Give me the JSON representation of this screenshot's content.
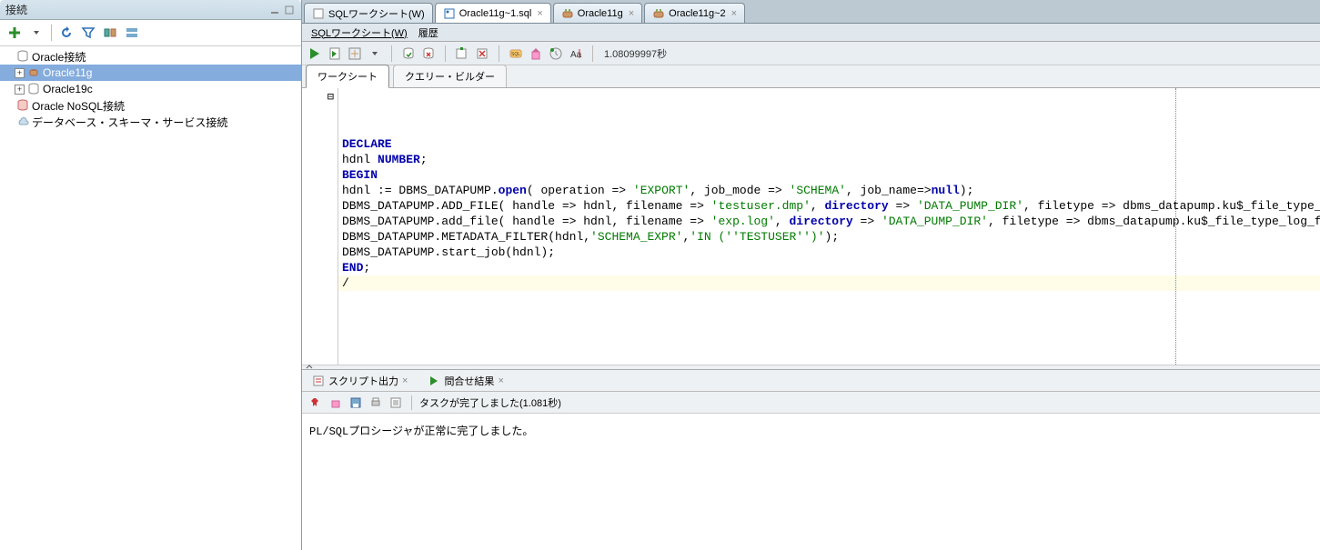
{
  "left": {
    "title": "接続",
    "tree": {
      "root": "Oracle接続",
      "items": [
        {
          "label": "Oracle11g",
          "selected": true,
          "expandable": true
        },
        {
          "label": "Oracle19c",
          "selected": false,
          "expandable": true
        }
      ],
      "nosql": "Oracle NoSQL接続",
      "dbservice": "データベース・スキーマ・サービス接続"
    }
  },
  "tabs": [
    {
      "label": "SQLワークシート(W)",
      "active": false,
      "icon": "sql"
    },
    {
      "label": "Oracle11g~1.sql",
      "active": true,
      "icon": "file"
    },
    {
      "label": "Oracle11g",
      "active": false,
      "icon": "conn"
    },
    {
      "label": "Oracle11g~2",
      "active": false,
      "icon": "conn"
    }
  ],
  "subtitle": {
    "ws": "SQLワークシート(W)",
    "history": "履歴"
  },
  "toolbar": {
    "duration": "1.08099997秒"
  },
  "wsTabs": {
    "worksheet": "ワークシート",
    "builder": "クエリー・ビルダー"
  },
  "code": {
    "lines": [
      [
        {
          "t": "DECLARE",
          "c": "kw"
        }
      ],
      [
        {
          "t": "hdnl "
        },
        {
          "t": "NUMBER",
          "c": "kw"
        },
        {
          "t": ";"
        }
      ],
      [
        {
          "t": "BEGIN",
          "c": "kw"
        }
      ],
      [
        {
          "t": "hdnl := DBMS_DATAPUMP."
        },
        {
          "t": "open",
          "c": "kw"
        },
        {
          "t": "( operation => "
        },
        {
          "t": "'EXPORT'",
          "c": "str"
        },
        {
          "t": ", job_mode => "
        },
        {
          "t": "'SCHEMA'",
          "c": "str"
        },
        {
          "t": ", job_name=>"
        },
        {
          "t": "null",
          "c": "kw"
        },
        {
          "t": ");"
        }
      ],
      [
        {
          "t": "DBMS_DATAPUMP.ADD_FILE( handle => hdnl, filename => "
        },
        {
          "t": "'testuser.dmp'",
          "c": "str"
        },
        {
          "t": ", "
        },
        {
          "t": "directory",
          "c": "kw"
        },
        {
          "t": " => "
        },
        {
          "t": "'DATA_PUMP_DIR'",
          "c": "str"
        },
        {
          "t": ", filetype => dbms_datapump.ku$_file_type_dump_file);"
        }
      ],
      [
        {
          "t": "DBMS_DATAPUMP.add_file( handle => hdnl, filename => "
        },
        {
          "t": "'exp.log'",
          "c": "str"
        },
        {
          "t": ", "
        },
        {
          "t": "directory",
          "c": "kw"
        },
        {
          "t": " => "
        },
        {
          "t": "'DATA_PUMP_DIR'",
          "c": "str"
        },
        {
          "t": ", filetype => dbms_datapump.ku$_file_type_log_file);"
        }
      ],
      [
        {
          "t": "DBMS_DATAPUMP.METADATA_FILTER(hdnl,"
        },
        {
          "t": "'SCHEMA_EXPR'",
          "c": "str"
        },
        {
          "t": ","
        },
        {
          "t": "'IN (''TESTUSER'')'",
          "c": "str"
        },
        {
          "t": ");"
        }
      ],
      [
        {
          "t": "DBMS_DATAPUMP.start_job(hdnl);"
        }
      ],
      [
        {
          "t": "END",
          "c": "kw"
        },
        {
          "t": ";"
        }
      ],
      [
        {
          "t": "/"
        }
      ]
    ],
    "currentLine": 9
  },
  "result": {
    "tabs": [
      {
        "label": "スクリプト出力",
        "icon": "script"
      },
      {
        "label": "問合せ結果",
        "icon": "run"
      }
    ],
    "status": "タスクが完了しました(1.081秒)",
    "output": "PL/SQLプロシージャが正常に完了しました。"
  }
}
